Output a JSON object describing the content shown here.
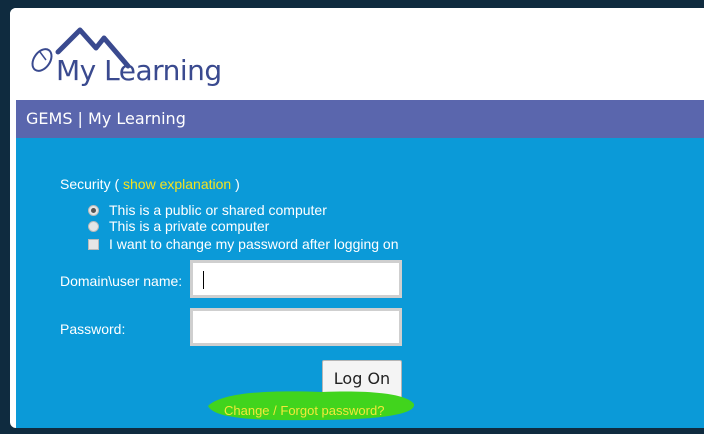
{
  "brand": {
    "logo_text": "My Learning",
    "accent": "#5a66ad",
    "panel_color": "#0b9ad8",
    "link_color": "#f6e21e"
  },
  "title_bar": {
    "text": "GEMS | My Learning"
  },
  "security": {
    "label": "Security (",
    "link": "show explanation",
    "label_end": ")",
    "options": [
      {
        "label": "This is a public or shared computer",
        "selected": true
      },
      {
        "label": "This is a private computer",
        "selected": false
      }
    ],
    "change_password": {
      "label": "I want to change my password after logging on",
      "checked": false
    }
  },
  "form": {
    "username_label": "Domain\\user name:",
    "username_value": "",
    "password_label": "Password:",
    "password_value": "",
    "logon_label": "Log On",
    "forgot_link": "Change / Forgot password?"
  }
}
